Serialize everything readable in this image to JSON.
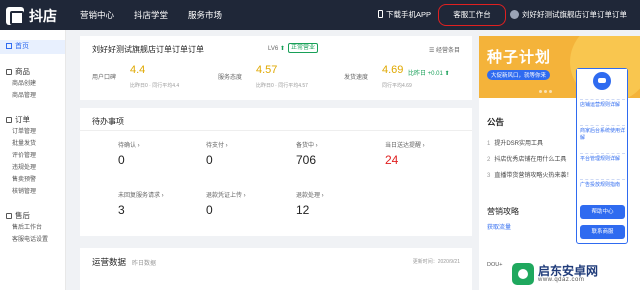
{
  "brand": {
    "name": "抖店"
  },
  "topnav": [
    "营销中心",
    "抖店学堂",
    "服务市场"
  ],
  "topright": {
    "download": "下载手机APP",
    "service": "客服工作台",
    "shop": "刘好好测试旗舰店订单订单订单"
  },
  "sidebar": {
    "home": "首页",
    "groups": [
      {
        "title": "商品",
        "items": [
          "商品创建",
          "商品管理"
        ]
      },
      {
        "title": "订单",
        "items": [
          "订单管理",
          "批量发货",
          "评价管理",
          "违规处理",
          "售卖预警",
          "核销管理"
        ]
      },
      {
        "title": "售后",
        "items": [
          "售后工作台",
          "客服电话设置"
        ]
      }
    ]
  },
  "shop_card": {
    "title": "刘好好测试旗舰店订单订单订单",
    "level": "LV6",
    "level_arrow": "⬆",
    "badge": "正常营业",
    "link": "经营条目",
    "metrics": [
      {
        "label": "用户口碑",
        "value": "4.4",
        "trend": "",
        "compare": "比昨日0 · 同行平均4.4"
      },
      {
        "label": "服务态度",
        "value": "4.57",
        "trend": "",
        "compare": "比昨日0 · 同行平均4.57"
      },
      {
        "label": "发货速度",
        "value": "4.69",
        "trend": "比昨日 +0.01 ⬆",
        "compare": "同行平均4.69"
      }
    ]
  },
  "todo_card": {
    "title": "待办事项",
    "rows": [
      [
        {
          "label": "待确认 ›",
          "value": "0",
          "highlight": false
        },
        {
          "label": "待支付 ›",
          "value": "0",
          "highlight": false
        },
        {
          "label": "备货中 ›",
          "value": "706",
          "highlight": false
        },
        {
          "label": "当日送达提醒 ›",
          "value": "24",
          "highlight": true
        }
      ],
      [
        {
          "label": "未回复服务请求 ›",
          "value": "3",
          "highlight": false
        },
        {
          "label": "退款凭证上传 ›",
          "value": "0",
          "highlight": false
        },
        {
          "label": "退款处理 ›",
          "value": "12",
          "highlight": false
        }
      ]
    ]
  },
  "ops_card": {
    "title": "运营数据",
    "subtitle": "昨日数据",
    "updated": "更新时间：2020/9/21"
  },
  "right": {
    "banner_title": "种子计划",
    "banner_pill": "大促新风口，就等你来",
    "notice_title": "公告",
    "notices": [
      {
        "n": "1",
        "text": "提升DSR实用工具"
      },
      {
        "n": "2",
        "text": "抖店优秀店铺在用什么工具"
      },
      {
        "n": "3",
        "text": "直播带货营销攻略火热来袭！"
      }
    ],
    "strategy_title": "营销攻略",
    "strategy_sub": "获取流量",
    "dou": "DOU+"
  },
  "helper": {
    "items": [
      "店铺运营规则详解",
      "商家后台系统使用详解",
      "平台管理规则详解",
      "广告投放规则指南"
    ],
    "help_center": "帮助中心",
    "contact": "联系商服"
  },
  "watermark": {
    "name": "启东安卓网",
    "url": "www.qdaz.com"
  }
}
